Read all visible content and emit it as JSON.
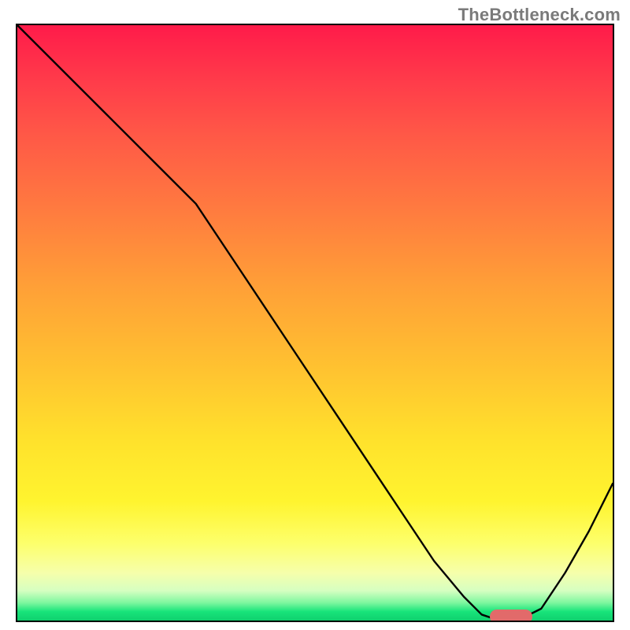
{
  "watermark_text": "TheBottleneck.com",
  "chart_data": {
    "type": "line",
    "title": "",
    "xlabel": "",
    "ylabel": "",
    "xlim": [
      0,
      100
    ],
    "ylim": [
      0,
      100
    ],
    "grid": false,
    "legend": false,
    "series": [
      {
        "name": "bottleneck-curve",
        "x": [
          0,
          8,
          16,
          23,
          30,
          38,
          46,
          54,
          62,
          70,
          75,
          78,
          81,
          84,
          88,
          92,
          96,
          100
        ],
        "y": [
          100,
          92,
          84,
          77,
          70,
          58,
          46,
          34,
          22,
          10,
          4,
          1,
          0,
          0,
          2,
          8,
          15,
          23
        ]
      }
    ],
    "marker": {
      "name": "optimum-range",
      "x_start": 79,
      "x_end": 86,
      "y": 1.2
    },
    "background": {
      "type": "vertical-gradient",
      "stops": [
        {
          "pos": 0.0,
          "color": "#ff1b4a"
        },
        {
          "pos": 0.3,
          "color": "#ff7840"
        },
        {
          "pos": 0.58,
          "color": "#ffc330"
        },
        {
          "pos": 0.8,
          "color": "#fff42f"
        },
        {
          "pos": 0.95,
          "color": "#d6ffc1"
        },
        {
          "pos": 1.0,
          "color": "#0fd06e"
        }
      ]
    }
  }
}
